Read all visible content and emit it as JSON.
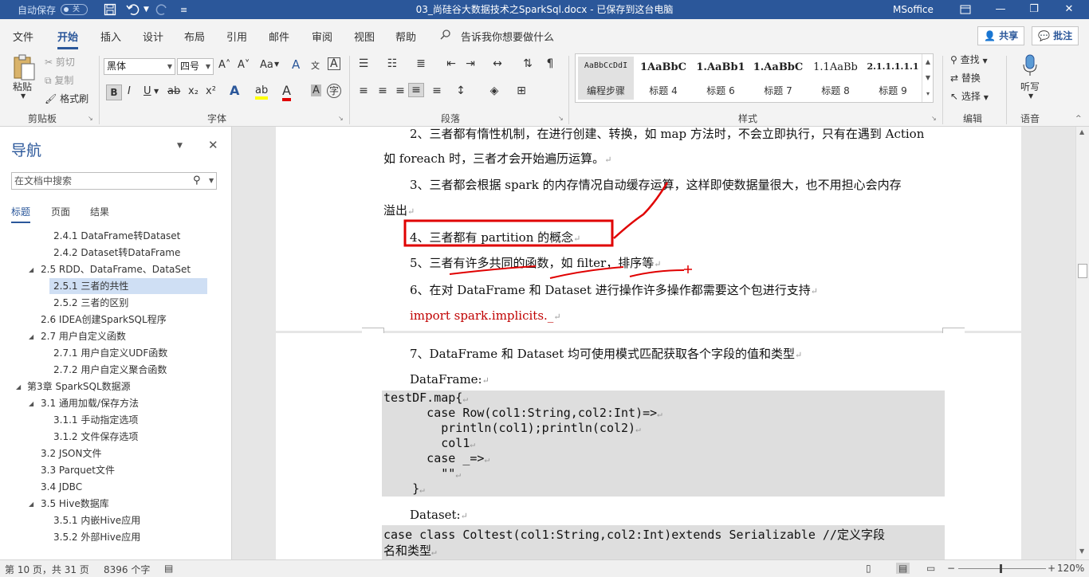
{
  "titlebar": {
    "autosave_label": "自动保存",
    "autosave_state": "关",
    "save_icon": "save-icon",
    "undo_icon": "undo-icon",
    "redo_icon": "redo-icon",
    "customize_icon": "customize-icon",
    "title": "03_尚硅谷大数据技术之SparkSql.docx  -  已保存到这台电脑",
    "account": "MSoffice",
    "minimize": "—",
    "restore": "❐",
    "close": "✕"
  },
  "menu": {
    "tabs": [
      "文件",
      "开始",
      "插入",
      "设计",
      "布局",
      "引用",
      "邮件",
      "审阅",
      "视图",
      "帮助"
    ],
    "active_tab": "开始",
    "tell_me": "告诉我你想要做什么",
    "share": "共享",
    "comments": "批注"
  },
  "ribbon": {
    "clipboard": {
      "paste": "粘贴",
      "cut": "剪切",
      "copy": "复制",
      "format_painter": "格式刷",
      "label": "剪贴板"
    },
    "font": {
      "font_name": "黑体",
      "font_size": "四号",
      "label": "字体",
      "bold": "B",
      "italic": "I",
      "underline": "U",
      "strike": "ab",
      "sub": "x₂",
      "sup": "x²",
      "grow": "A˄",
      "shrink": "A˅",
      "case": "Aa",
      "clear": "A",
      "phonetic": "文",
      "border": "A",
      "effects": "A",
      "highlight": "ab",
      "color": "A",
      "shading": "A",
      "enclose": "字"
    },
    "paragraph": {
      "label": "段落"
    },
    "styles": {
      "label": "样式",
      "items": [
        {
          "sample": "AaBbCcDdI",
          "name": "编程步骤"
        },
        {
          "sample": "1AaBbC",
          "name": "标题 4"
        },
        {
          "sample": "1.AaBb1",
          "name": "标题 6"
        },
        {
          "sample": "1.AaBbC",
          "name": "标题 7"
        },
        {
          "sample": "1.1AaBb",
          "name": "标题 8"
        },
        {
          "sample": "2.1.1.1.1.1",
          "name": "标题 9"
        }
      ]
    },
    "editing": {
      "find": "查找",
      "replace": "替换",
      "select": "选择",
      "label": "编辑"
    },
    "voice": {
      "dictate": "听写",
      "label": "语音"
    }
  },
  "nav": {
    "title": "导航",
    "search_placeholder": "在文档中搜索",
    "tabs": [
      "标题",
      "页面",
      "结果"
    ],
    "items": [
      {
        "text": "2.4.1 DataFrame转Dataset",
        "level": 3,
        "expand": ""
      },
      {
        "text": "2.4.2 Dataset转DataFrame",
        "level": 3,
        "expand": ""
      },
      {
        "text": "2.5 RDD、DataFrame、DataSet",
        "level": 2,
        "expand": "◢"
      },
      {
        "text": "2.5.1 三者的共性",
        "level": 3,
        "expand": "",
        "selected": true
      },
      {
        "text": "2.5.2 三者的区别",
        "level": 3,
        "expand": ""
      },
      {
        "text": "2.6 IDEA创建SparkSQL程序",
        "level": 2,
        "expand": ""
      },
      {
        "text": "2.7 用户自定义函数",
        "level": 2,
        "expand": "◢"
      },
      {
        "text": "2.7.1 用户自定义UDF函数",
        "level": 3,
        "expand": ""
      },
      {
        "text": "2.7.2 用户自定义聚合函数",
        "level": 3,
        "expand": ""
      },
      {
        "text": "第3章 SparkSQL数据源",
        "level": 1,
        "expand": "◢"
      },
      {
        "text": "3.1 通用加载/保存方法",
        "level": 2,
        "expand": "◢"
      },
      {
        "text": "3.1.1 手动指定选项",
        "level": 3,
        "expand": ""
      },
      {
        "text": "3.1.2 文件保存选项",
        "level": 3,
        "expand": ""
      },
      {
        "text": "3.2 JSON文件",
        "level": 2,
        "expand": ""
      },
      {
        "text": "3.3 Parquet文件",
        "level": 2,
        "expand": ""
      },
      {
        "text": "3.4 JDBC",
        "level": 2,
        "expand": ""
      },
      {
        "text": "3.5 Hive数据库",
        "level": 2,
        "expand": "◢"
      },
      {
        "text": "3.5.1 内嵌Hive应用",
        "level": 3,
        "expand": ""
      },
      {
        "text": "3.5.2 外部Hive应用",
        "level": 3,
        "expand": ""
      }
    ]
  },
  "document": {
    "page1": [
      "2、三者都有惰性机制，在进行创建、转换，如 map 方法时，不会立即执行，只有在遇到 Action",
      "如 foreach 时，三者才会开始遍历运算。",
      "3、三者都会根据 spark 的内存情况自动缓存运算，这样即使数据量很大，也不用担心会内存",
      "溢出",
      "4、三者都有 partition 的概念",
      "5、三者有许多共同的函数，如 filter，排序等",
      "6、在对 DataFrame 和 Dataset 进行操作许多操作都需要这个包进行支持",
      "import spark.implicits._"
    ],
    "page2": {
      "p7": "7、DataFrame 和 Dataset 均可使用模式匹配获取各个字段的值和类型",
      "dataframe_label": "DataFrame:",
      "code1": [
        "testDF.map{",
        "      case Row(col1:String,col2:Int)=>",
        "        println(col1);println(col2)",
        "        col1",
        "      case _=>",
        "        \"\"",
        "    }"
      ],
      "dataset_label": "Dataset:",
      "code2": [
        "case class Coltest(col1:String,col2:Int)extends Serializable //定义字段",
        "名和类型"
      ]
    },
    "para_mark": "↵"
  },
  "status": {
    "page": "第 10 页，共 31 页",
    "words": "8396 个字",
    "zoom": "120%"
  },
  "colors": {
    "accent": "#2b579a",
    "annotation": "#e00000"
  }
}
